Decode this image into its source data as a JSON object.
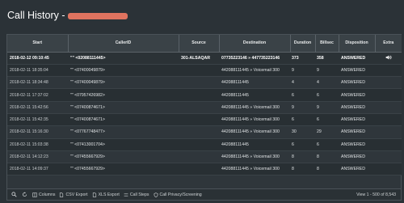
{
  "page": {
    "title": "Call History -"
  },
  "table": {
    "headers": {
      "start": "Start",
      "callerid": "CallerID",
      "source": "Source",
      "destination": "Destination",
      "duration": "Duration",
      "billsec": "Billsec",
      "disposition": "Disposition",
      "extra": "Extra"
    },
    "rows": [
      {
        "start": "2018-02-12 09:10:45",
        "callerid": "\"\" <02088111445>",
        "source": "301-ALSAQAR",
        "destination": "07735223146 » 447735223146",
        "duration": "373",
        "billsec": "358",
        "disposition": "ANSWERED",
        "has_extra": true
      },
      {
        "start": "2018-02-11 18:35:04",
        "callerid": "\"\" <07400049879>",
        "source": "",
        "destination": "442088111445 » Voicemail 300",
        "duration": "9",
        "billsec": "9",
        "disposition": "ANSWERED"
      },
      {
        "start": "2018-02-11 18:34:48",
        "callerid": "\"\" <07400049879>",
        "source": "",
        "destination": "442088111445",
        "duration": "4",
        "billsec": "4",
        "disposition": "ANSWERED"
      },
      {
        "start": "2018-02-11 17:37:02",
        "callerid": "\"\" <07957426982>",
        "source": "",
        "destination": "442088111445",
        "duration": "6",
        "billsec": "6",
        "disposition": "ANSWERED"
      },
      {
        "start": "2018-02-11 15:42:56",
        "callerid": "\"\" <07400874671>",
        "source": "",
        "destination": "442088111445 » Voicemail 300",
        "duration": "9",
        "billsec": "9",
        "disposition": "ANSWERED"
      },
      {
        "start": "2018-02-11 15:42:35",
        "callerid": "\"\" <07400874671>",
        "source": "",
        "destination": "442088111445 » Voicemail 300",
        "duration": "6",
        "billsec": "6",
        "disposition": "ANSWERED"
      },
      {
        "start": "2018-02-11 15:16:30",
        "callerid": "\"\" <07767748477>",
        "source": "",
        "destination": "442088111445 » Voicemail 300",
        "duration": "30",
        "billsec": "29",
        "disposition": "ANSWERED"
      },
      {
        "start": "2018-02-11 15:03:38",
        "callerid": "\"\" <07413001704>",
        "source": "",
        "destination": "442088111445",
        "duration": "6",
        "billsec": "6",
        "disposition": "ANSWERED"
      },
      {
        "start": "2018-02-11 14:12:23",
        "callerid": "\"\" <07455667929>",
        "source": "",
        "destination": "442088111445 » Voicemail 300",
        "duration": "8",
        "billsec": "8",
        "disposition": "ANSWERED"
      },
      {
        "start": "2018-02-11 14:09:37",
        "callerid": "\"\" <07455667929>",
        "source": "",
        "destination": "442088111445 » Voicemail 300",
        "duration": "8",
        "billsec": "8",
        "disposition": "ANSWERED"
      }
    ]
  },
  "footer": {
    "columns": "Columns",
    "csv_export": "CSV Export",
    "xls_export": "XLS Export",
    "call_steps": "Call Steps",
    "call_privacy": "Call Privacy/Screening",
    "viewing": "View 1 - 500 of 8,543"
  },
  "icons": {
    "search": "search-icon",
    "refresh": "refresh-icon",
    "speaker": "speaker-icon"
  },
  "colors": {
    "background": "#2b3237",
    "accent_redaction": "#e0735f"
  }
}
